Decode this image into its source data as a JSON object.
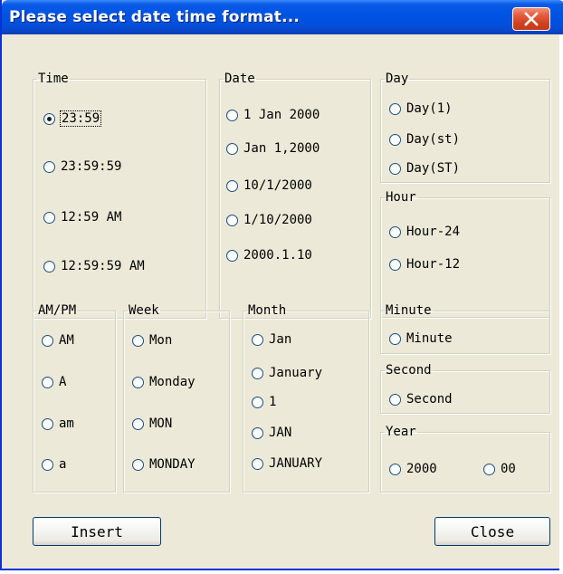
{
  "window": {
    "title": "Please select date time format..."
  },
  "groups": {
    "time": {
      "legend": "Time",
      "options": [
        "23:59",
        "23:59:59",
        "12:59 AM",
        "12:59:59 AM"
      ],
      "selected": 0
    },
    "date": {
      "legend": "Date",
      "options": [
        "1 Jan 2000",
        "Jan 1,2000",
        "10/1/2000",
        "1/10/2000",
        "2000.1.10"
      ]
    },
    "day": {
      "legend": "Day",
      "options": [
        "Day(1)",
        "Day(st)",
        "Day(ST)"
      ]
    },
    "hour": {
      "legend": "Hour",
      "options": [
        "Hour-24",
        "Hour-12"
      ]
    },
    "ampm": {
      "legend": "AM/PM",
      "options": [
        "AM",
        "A",
        "am",
        "a"
      ]
    },
    "week": {
      "legend": "Week",
      "options": [
        "Mon",
        "Monday",
        "MON",
        "MONDAY"
      ]
    },
    "month": {
      "legend": "Month",
      "options": [
        "Jan",
        "January",
        "1",
        "JAN",
        "JANUARY"
      ]
    },
    "minute": {
      "legend": "Minute",
      "options": [
        "Minute"
      ]
    },
    "second": {
      "legend": "Second",
      "options": [
        "Second"
      ]
    },
    "year": {
      "legend": "Year",
      "options": [
        "2000",
        "00"
      ]
    }
  },
  "buttons": {
    "insert": "Insert",
    "close": "Close"
  },
  "icons": {
    "close": "close-x-icon",
    "radio": "radio-button-icon"
  },
  "colors": {
    "titlebar": "#0054e3",
    "window_bg": "#ece9d8",
    "close_button": "#e35a3a"
  }
}
